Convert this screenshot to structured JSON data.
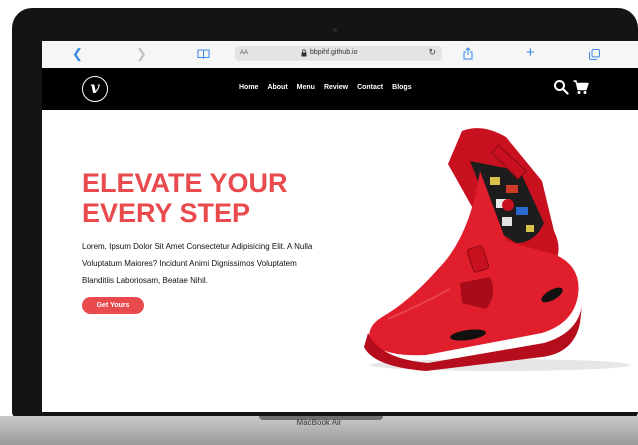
{
  "browser": {
    "text_size_label": "AA",
    "url": "bbpihf.github.io"
  },
  "site": {
    "logo_letter": "v",
    "menu": [
      "Home",
      "About",
      "Menu",
      "Review",
      "Contact",
      "Blogs"
    ]
  },
  "hero": {
    "title_line1": "ELEVATE YOUR",
    "title_line2": "EVERY STEP",
    "desc_line1": "Lorem, Ipsum Dolor Sit Amet Consectetur Adipisicing Elit. A Nulla",
    "desc_line2": "Voluptatum Maiores? Incidunt Animi Dignissimos Voluptatem",
    "desc_line3": "Blanditiis Laboriosam, Beatae Nihil.",
    "cta_label": "Get Yours"
  },
  "device": {
    "label": "MacBook Air"
  },
  "colors": {
    "accent": "#e84a4e",
    "nav_bg": "#000000",
    "browser_link": "#3a8be8"
  },
  "icons": [
    "back-icon",
    "forward-icon",
    "bookmarks-icon",
    "lock-icon",
    "reload-icon",
    "share-icon",
    "new-tab-icon",
    "tabs-icon",
    "search-icon",
    "cart-icon"
  ]
}
